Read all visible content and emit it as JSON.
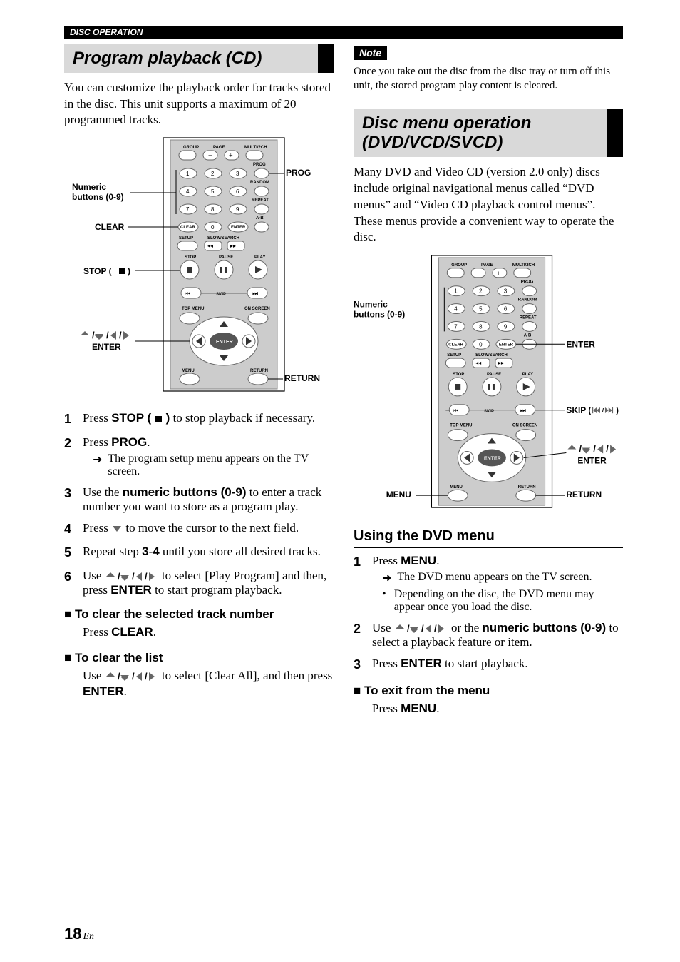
{
  "header": {
    "section_label": "DISC OPERATION"
  },
  "left": {
    "title": "Program playback (CD)",
    "intro": "You can customize the playback order for tracks stored in the disc. This unit supports a maximum of 20 programmed tracks.",
    "remote_labels": {
      "numeric": "Numeric\nbuttons (0-9)",
      "clear": "CLEAR",
      "stop": "STOP (",
      "nav": "ENTER",
      "prog": "PROG",
      "return": "RETURN",
      "group": "GROUP",
      "page": "PAGE",
      "multi": "MULTI/2CH",
      "progword": "PROG",
      "random": "RANDOM",
      "repeat": "REPEAT",
      "ab": "A-B",
      "clearb": "CLEAR",
      "enterb": "ENTER",
      "setup": "SETUP",
      "slow": "SLOW/SEARCH",
      "stopw": "STOP",
      "pause": "PAUSE",
      "play": "PLAY",
      "skip": "SKIP",
      "topmenu": "TOP MENU",
      "onscreen": "ON SCREEN",
      "menuw": "MENU",
      "returnw": "RETURN"
    },
    "steps": [
      {
        "pre": "Press ",
        "b1": "STOP ( ",
        "mid": " )",
        "post": " to stop playback if necessary."
      },
      {
        "pre": "Press ",
        "b1": "PROG",
        "post": ".",
        "arrow": "The program setup menu appears on the TV screen."
      },
      {
        "pre": "Use the ",
        "b1": "numeric buttons (0-9)",
        "post": " to enter a track number you want to store as a program play."
      },
      {
        "pre": "Press ",
        "post_after_icon": " to move the cursor to the next field."
      },
      {
        "pre": "Repeat step ",
        "b1": "3",
        "mid": "-",
        "b2": "4",
        "post": " until you store all desired tracks."
      },
      {
        "pre": "Use ",
        "nav": true,
        "mid_after_nav": " to select [Play Program] and then, press ",
        "b1": "ENTER",
        "post": " to start program playback."
      }
    ],
    "clear_selected_head": "■ To clear the selected track number",
    "clear_selected_body_pre": "Press ",
    "clear_selected_body_b": "CLEAR",
    "clear_selected_body_post": ".",
    "clear_list_head": "■ To clear the list",
    "clear_list_pre": "Use ",
    "clear_list_mid": " to select [Clear All], and then press ",
    "clear_list_b": "ENTER",
    "clear_list_post": "."
  },
  "right": {
    "note_label": "Note",
    "note_text": "Once you take out the disc from the disc tray or turn off this unit, the stored program play content is cleared.",
    "title": "Disc menu operation (DVD/VCD/SVCD)",
    "intro": "Many DVD and Video CD (version 2.0 only) discs include original navigational menus called “DVD menus” and “Video CD playback control menus”. These menus provide a convenient way to operate the disc.",
    "remote_labels": {
      "numeric": "Numeric\nbuttons (0-9)",
      "enter_r": "ENTER",
      "skip_r": "SKIP (",
      "nav_r": "ENTER",
      "menu_r": "MENU",
      "return_r": "RETURN"
    },
    "subsection": "Using the DVD menu",
    "steps": [
      {
        "pre": "Press ",
        "b1": "MENU",
        "post": ".",
        "arrow": "The DVD menu appears on the TV screen.",
        "bullet": "Depending on the disc, the DVD menu may appear once you load the disc."
      },
      {
        "pre": "Use ",
        "nav": true,
        "mid_after_nav": " or the ",
        "b1": "numeric buttons (0-9)",
        "post": " to select a playback feature or item."
      },
      {
        "pre": "Press ",
        "b1": "ENTER",
        "post": " to start playback."
      }
    ],
    "exit_head": "■ To exit from the menu",
    "exit_pre": "Press ",
    "exit_b": "MENU",
    "exit_post": "."
  },
  "footer": {
    "page": "18",
    "suffix": "En"
  }
}
